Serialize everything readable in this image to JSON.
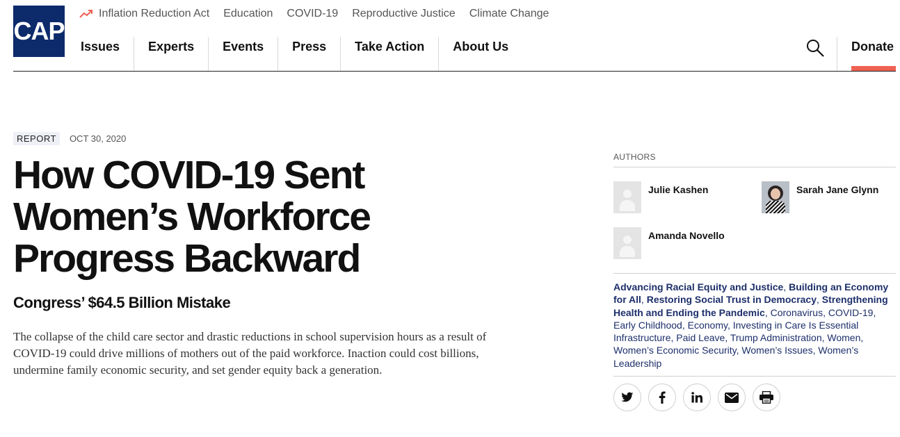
{
  "header": {
    "logo_text": "CAP",
    "topics": [
      "Inflation Reduction Act",
      "Education",
      "COVID-19",
      "Reproductive Justice",
      "Climate Change"
    ],
    "nav": [
      "Issues",
      "Experts",
      "Events",
      "Press",
      "Take Action",
      "About Us"
    ],
    "donate_label": "Donate",
    "brand_color": "#0d2a6b",
    "accent_color": "#ef6253"
  },
  "article": {
    "type": "REPORT",
    "date": "OCT 30, 2020",
    "title_lines": [
      "How COVID-19 Sent",
      "Women’s Workforce",
      "Progress Backward"
    ],
    "subtitle": "Congress’ $64.5 Billion Mistake",
    "summary": "The collapse of the child care sector and drastic reductions in school supervision hours as a result of COVID-19 could drive millions of mothers out of the paid workforce. Inaction could cost billions, undermine family economic security, and set gender equity back a generation."
  },
  "sidebar": {
    "authors_label": "AUTHORS",
    "authors": [
      {
        "name": "Julie Kashen",
        "avatar": "placeholder-avatar-icon"
      },
      {
        "name": "Sarah Jane Glynn",
        "avatar": "photo"
      },
      {
        "name": "Amanda Novello",
        "avatar": "placeholder-avatar-icon"
      }
    ],
    "tags": [
      "Advancing Racial Equity and Justice",
      "Building an Economy for All",
      "Restoring Social Trust in Democracy",
      "Strengthening Health and Ending the Pandemic",
      "Coronavirus",
      "COVID-19",
      "Early Childhood",
      "Economy",
      "Investing in Care Is Essential Infrastructure",
      "Paid Leave",
      "Trump Administration",
      "Women",
      "Women’s Economic Security",
      "Women’s Issues",
      "Women’s Leadership"
    ],
    "share_buttons": [
      "twitter-icon",
      "facebook-icon",
      "linkedin-icon",
      "email-icon",
      "print-icon"
    ]
  }
}
